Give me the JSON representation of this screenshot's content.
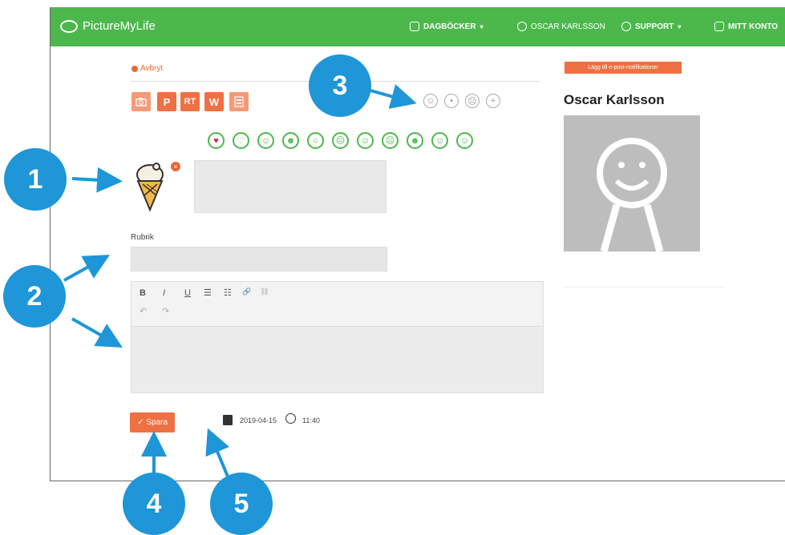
{
  "app": {
    "brand": "PictureMyLife",
    "nav": [
      {
        "label": "DAGBÖCKER",
        "caret": "▾"
      },
      {
        "label": "OSCAR KARLSSON"
      },
      {
        "label": "SUPPORT",
        "caret": "▾"
      },
      {
        "label": "MITT KONTO"
      }
    ]
  },
  "form": {
    "cancel_label": "Avbryt",
    "tools": [
      "camera-icon",
      "P",
      "RT",
      "W",
      "image-icon"
    ],
    "small_moods": [
      "smile-icon",
      "neutral-icon",
      "sad-icon",
      "plus-icon"
    ],
    "small_mood_glyphs": [
      "☺",
      "•",
      "☹",
      "+"
    ],
    "moods": [
      "heart-icon",
      "love-eyes-icon",
      "smile-icon",
      "laugh-icon",
      "surprised-icon",
      "sad-icon",
      "blush-icon",
      "cry-icon",
      "grin-icon",
      "cool-icon",
      "wink-icon"
    ],
    "mood_glyphs": [
      "♥",
      "♡",
      "☺",
      "☻",
      "○",
      "☹",
      "☺",
      "☹",
      "☻",
      "☺",
      "☺"
    ],
    "rubrik_label": "Rubrik",
    "editor_buttons": [
      "B",
      "I",
      "U",
      "☰",
      "☷",
      "🔗",
      "⛓",
      "↶",
      "↷"
    ],
    "save_label": "Spara",
    "save_check": "✓",
    "date": "2019-04-15",
    "time": "11:40",
    "remove_glyph": "×"
  },
  "sidebar": {
    "notify_label": "Lägg till e-post-notifikationer",
    "user_name": "Oscar Karlsson"
  },
  "callouts": [
    "1",
    "2",
    "3",
    "4",
    "5"
  ],
  "colors": {
    "green": "#4cb84c",
    "orange": "#ee7043",
    "blue": "#1e96d8"
  }
}
